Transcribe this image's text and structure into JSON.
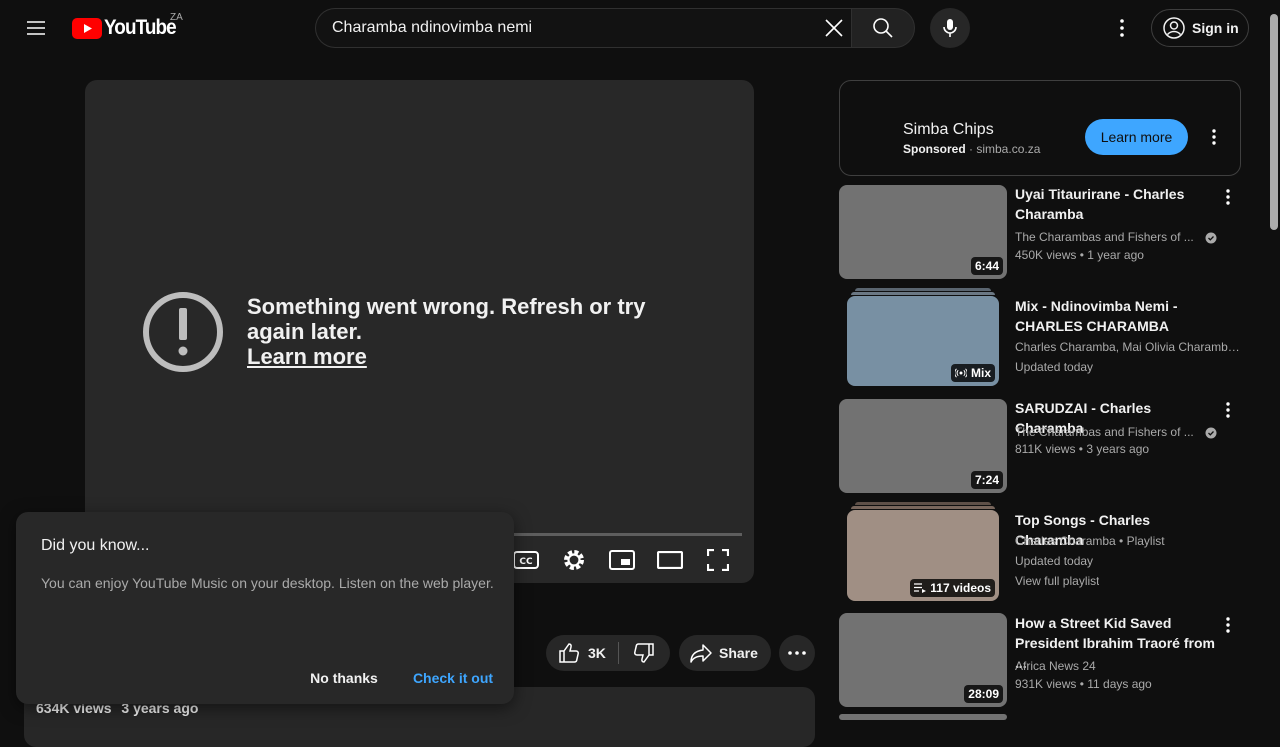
{
  "header": {
    "logo_text": "YouTube",
    "country": "ZA",
    "search_value": "Charamba ndinovimba nemi",
    "sign_in": "Sign in"
  },
  "player": {
    "error_message": "Something went wrong. Refresh or try again later.",
    "learn_more": "Learn more"
  },
  "actions": {
    "like_count": "3K",
    "share_label": "Share"
  },
  "description": {
    "views": "634K views",
    "age": "3 years ago"
  },
  "toast": {
    "title": "Did you know...",
    "body": "You can enjoy YouTube Music on your desktop. Listen on the web player.",
    "dismiss": "No thanks",
    "confirm": "Check it out"
  },
  "ad": {
    "name": "Simba Chips",
    "sponsored": "Sponsored",
    "domain": "simba.co.za",
    "cta": "Learn more"
  },
  "recommendations": [
    {
      "title": "Uyai Titaurirane - Charles Charamba",
      "channel": "The Charambas and Fishers of ...",
      "meta": "450K views • 1 year ago",
      "badge": "6:44"
    },
    {
      "title": "Mix - Ndinovimba Nemi - CHARLES CHARAMBA",
      "channel": "Charles Charamba, Mai Olivia Charamba,...",
      "meta": "Updated today",
      "badge": "Mix"
    },
    {
      "title": "SARUDZAI - Charles Charamba",
      "channel": "The Charambas and Fishers of ...",
      "meta": "811K views • 3 years ago",
      "badge": "7:24"
    },
    {
      "title": "Top Songs - Charles Charamba",
      "channel": "Charles Charamba • Playlist",
      "meta": "Updated today",
      "extra": "View full playlist",
      "badge": "117 videos"
    },
    {
      "title": "How a Street Kid Saved President Ibrahim Traoré from ...",
      "channel": "Africa News 24",
      "meta": "931K views • 11 days ago",
      "badge": "28:09"
    }
  ],
  "colors": {
    "background": "#0f0f0f",
    "accent_blue": "#3ea6ff",
    "youtube_red": "#ff0000"
  }
}
